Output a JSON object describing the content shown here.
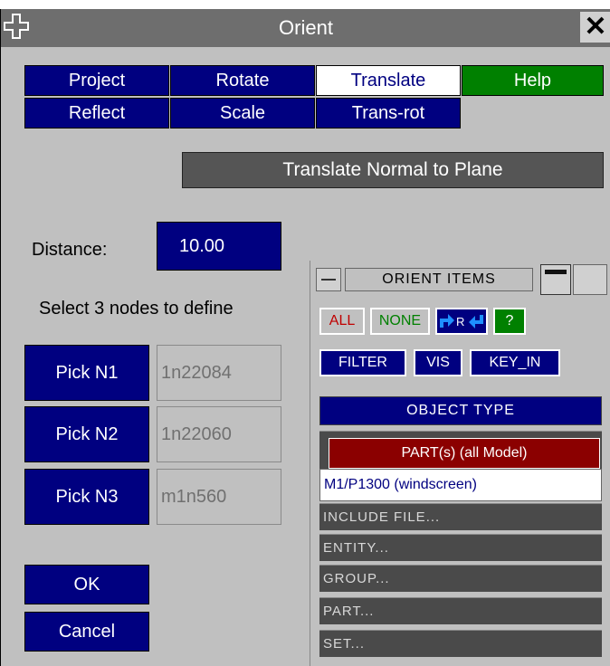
{
  "window": {
    "title": "Orient"
  },
  "tabs": {
    "project": "Project",
    "rotate": "Rotate",
    "translate": "Translate",
    "help": "Help",
    "reflect": "Reflect",
    "scale": "Scale",
    "trans_rot": "Trans-rot"
  },
  "translate_normal_label": "Translate Normal to Plane",
  "distance": {
    "label": "Distance:",
    "value": "10.00"
  },
  "instruction": "Select 3 nodes to define",
  "picks": [
    {
      "button": "Pick N1",
      "value": "1n22084"
    },
    {
      "button": "Pick N2",
      "value": "1n22060"
    },
    {
      "button": "Pick N3",
      "value": "m1n560"
    }
  ],
  "ok_label": "OK",
  "cancel_label": "Cancel",
  "popup": {
    "title": "ORIENT ITEMS",
    "buttons": {
      "all": "ALL",
      "none": "NONE",
      "question": "?",
      "filter": "FILTER",
      "vis": "VIS",
      "key_in": "KEY_IN"
    },
    "object_type": "OBJECT TYPE",
    "selected": "PART(s) (all Model)",
    "highlight": "M1/P1300 (windscreen)",
    "items": [
      "INCLUDE FILE...",
      "ENTITY...",
      "GROUP...",
      "PART...",
      "SET..."
    ]
  },
  "icons": {
    "move": "move-icon",
    "close": "close-icon",
    "pick_reverse": "pick-reverse-icon"
  },
  "colors": {
    "navy": "#000080",
    "green": "#008000",
    "dark_red": "#8b0000",
    "bg": "#c0c0c0"
  }
}
